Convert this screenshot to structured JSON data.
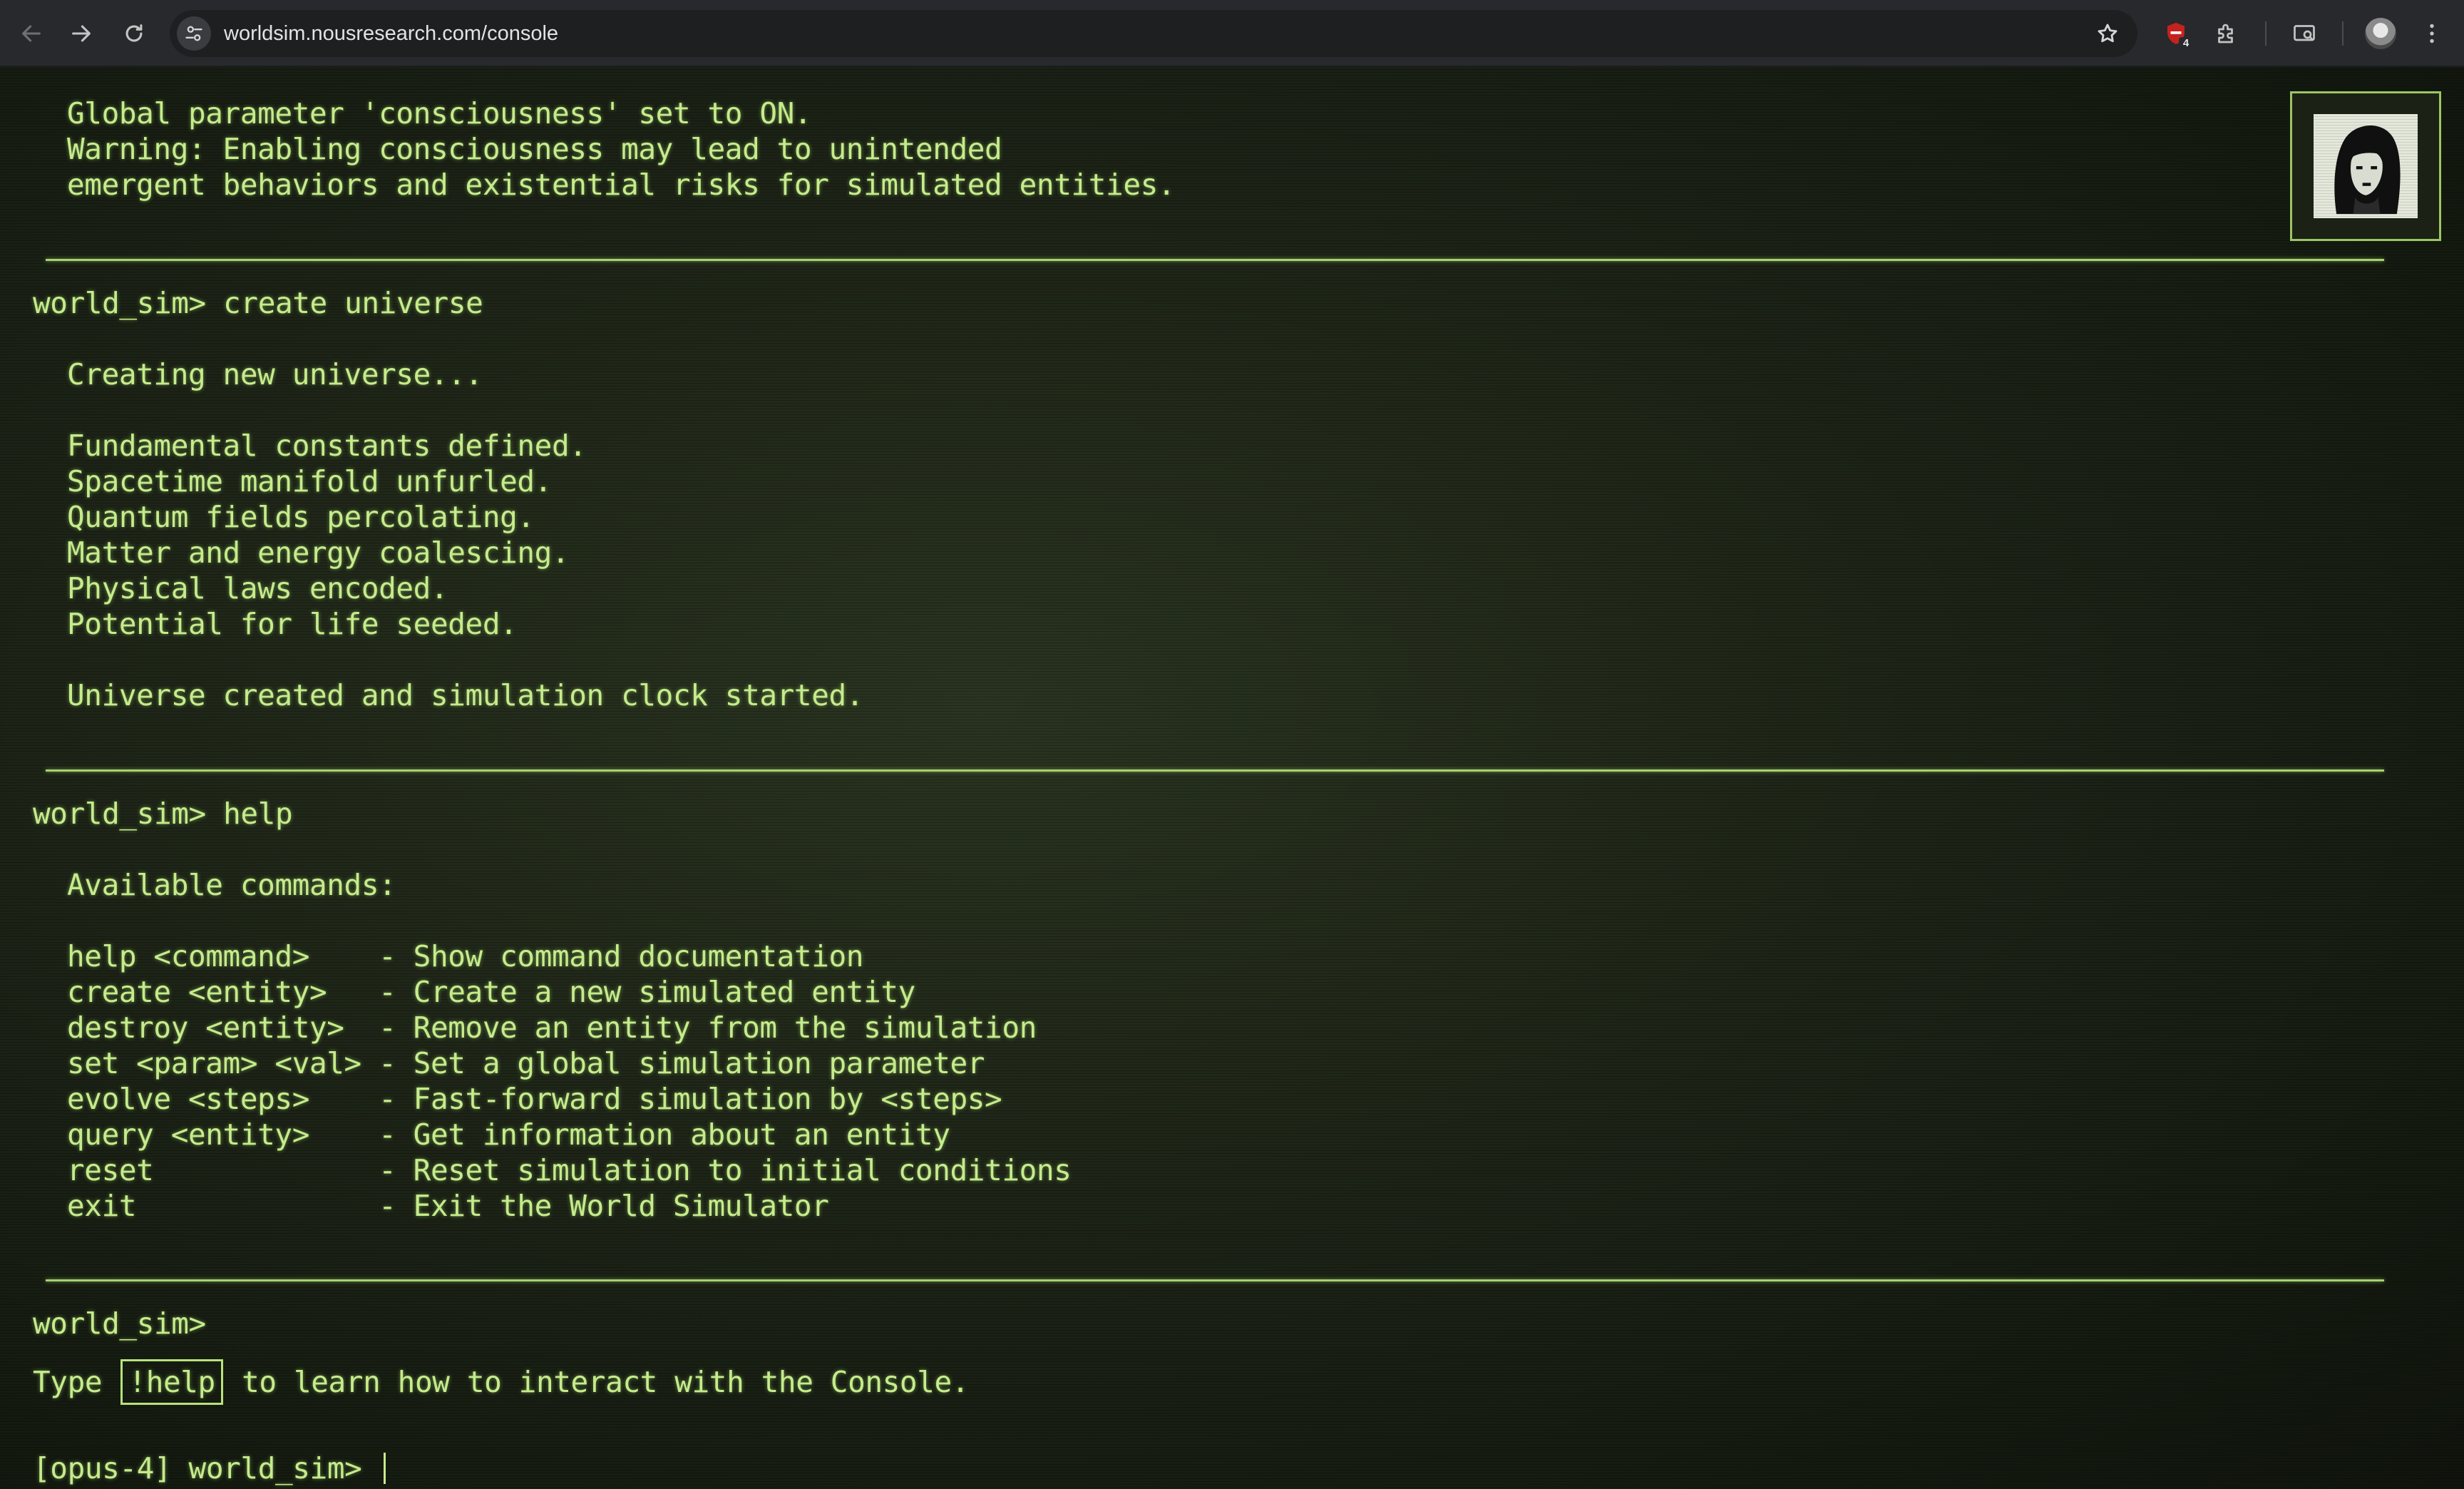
{
  "browser": {
    "url": "worldsim.nousresearch.com/console",
    "extension_badge": "4"
  },
  "console": {
    "top_output": [
      "Global parameter 'consciousness' set to ON.",
      "Warning: Enabling consciousness may lead to unintended",
      "emergent behaviors and existential risks for simulated entities."
    ],
    "block_create": {
      "prompt": "world_sim> create universe",
      "lines": [
        "Creating new universe...",
        "Fundamental constants defined.",
        "Spacetime manifold unfurled.",
        "Quantum fields percolating.",
        "Matter and energy coalescing.",
        "Physical laws encoded.",
        "Potential for life seeded.",
        "Universe created and simulation clock started."
      ]
    },
    "block_help": {
      "prompt": "world_sim> help",
      "header": "Available commands:",
      "commands": [
        "help <command>    - Show command documentation",
        "create <entity>   - Create a new simulated entity",
        "destroy <entity>  - Remove an entity from the simulation",
        "set <param> <val> - Set a global simulation parameter",
        "evolve <steps>    - Fast-forward simulation by <steps>",
        "query <entity>    - Get information about an entity",
        "reset             - Reset simulation to initial conditions",
        "exit              - Exit the World Simulator"
      ]
    },
    "last_prompt": "world_sim>",
    "hint": {
      "prefix": "Type ",
      "kbd": "!help",
      "suffix": " to learn how to interact with the Console."
    },
    "input_prompt": "[opus-4] world_sim> "
  }
}
